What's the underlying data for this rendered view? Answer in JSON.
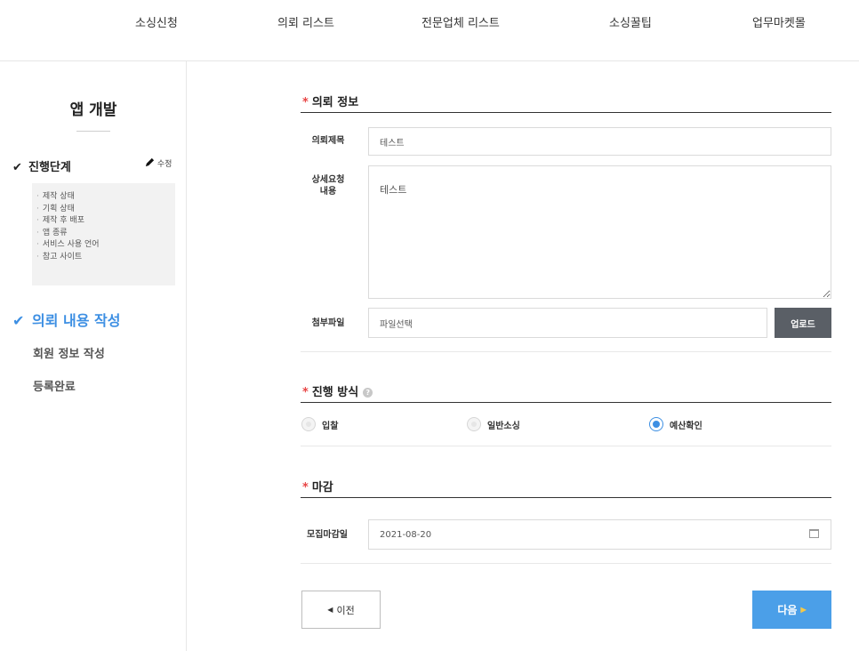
{
  "nav": {
    "items": [
      "소싱신청",
      "의뢰 리스트",
      "전문업체 리스트",
      "소싱꿀팁",
      "업무마켓몰"
    ]
  },
  "sidebar": {
    "title": "앱 개발",
    "step1": {
      "check": "✔",
      "label": "진행단계",
      "edit_label": "수정"
    },
    "substeps": [
      "제작 상태",
      "기획 상태",
      "제작 후 배포",
      "앱 종류",
      "서비스 사용 언어",
      "참고 사이트"
    ],
    "step2": {
      "check": "✔",
      "label": "의뢰 내용 작성"
    },
    "step3": "회원 정보 작성",
    "step4": "등록완료"
  },
  "form": {
    "request_section": {
      "required_mark": "*",
      "title": "의뢰 정보"
    },
    "title_label": "의뢰제목",
    "title_value": "테스트",
    "detail_label_line1": "상세요청",
    "detail_label_line2": "내용",
    "detail_value": "테스트",
    "file_label": "첨부파일",
    "file_placeholder": "파일선택",
    "upload_label": "업로드",
    "method_section": {
      "required_mark": "*",
      "title": "진행 방식",
      "help": "?"
    },
    "methods": [
      {
        "label": "입찰",
        "selected": false
      },
      {
        "label": "일반소싱",
        "selected": false
      },
      {
        "label": "예산확인",
        "selected": true
      }
    ],
    "deadline_section": {
      "required_mark": "*",
      "title": "마감"
    },
    "deadline_label": "모집마감일",
    "deadline_value": "2021-08-20",
    "prev_label": "이전",
    "next_label": "다음"
  },
  "colors": {
    "accent": "#3d8fe3",
    "next_button": "#4b9fe8",
    "required": "#e84545",
    "upload_button": "#5a5f66"
  }
}
